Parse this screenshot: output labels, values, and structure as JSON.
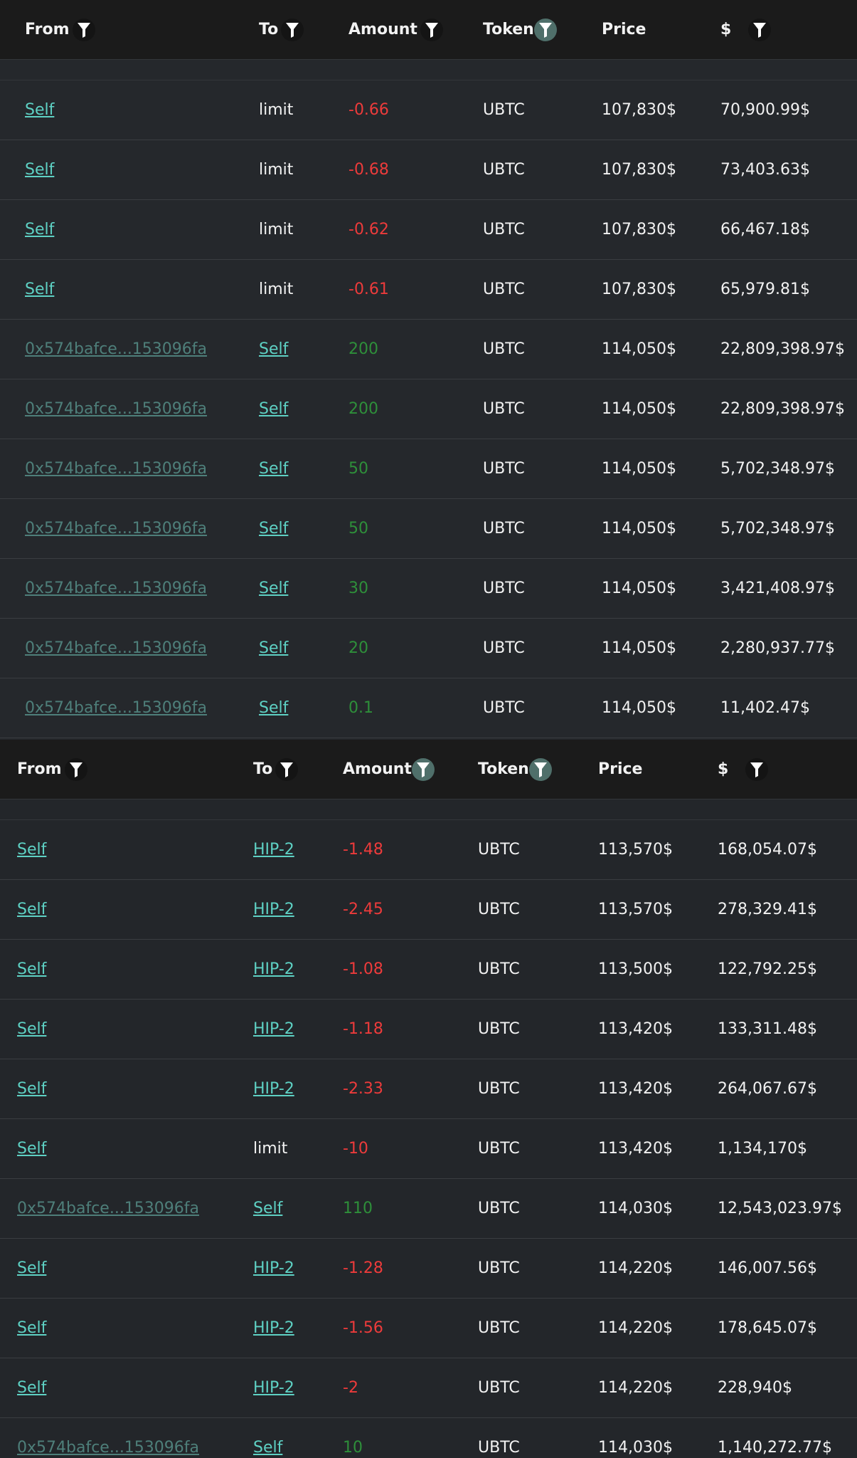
{
  "table1": {
    "headers": {
      "from": "From",
      "to": "To",
      "amount": "Amount",
      "token": "Token",
      "price": "Price",
      "usd": "$"
    },
    "active_filters": [
      "token"
    ],
    "rows": [
      {
        "from": "Self",
        "from_type": "link",
        "to": "limit",
        "to_type": "plain",
        "amount": "-0.66",
        "amount_sign": "neg",
        "token": "UBTC",
        "price": "107,830$",
        "usd": "70,900.99$"
      },
      {
        "from": "Self",
        "from_type": "link",
        "to": "limit",
        "to_type": "plain",
        "amount": "-0.68",
        "amount_sign": "neg",
        "token": "UBTC",
        "price": "107,830$",
        "usd": "73,403.63$"
      },
      {
        "from": "Self",
        "from_type": "link",
        "to": "limit",
        "to_type": "plain",
        "amount": "-0.62",
        "amount_sign": "neg",
        "token": "UBTC",
        "price": "107,830$",
        "usd": "66,467.18$"
      },
      {
        "from": "Self",
        "from_type": "link",
        "to": "limit",
        "to_type": "plain",
        "amount": "-0.61",
        "amount_sign": "neg",
        "token": "UBTC",
        "price": "107,830$",
        "usd": "65,979.81$"
      },
      {
        "from": "0x574bafce...153096fa",
        "from_type": "addr",
        "to": "Self",
        "to_type": "link",
        "amount": "200",
        "amount_sign": "pos",
        "token": "UBTC",
        "price": "114,050$",
        "usd": "22,809,398.97$"
      },
      {
        "from": "0x574bafce...153096fa",
        "from_type": "addr",
        "to": "Self",
        "to_type": "link",
        "amount": "200",
        "amount_sign": "pos",
        "token": "UBTC",
        "price": "114,050$",
        "usd": "22,809,398.97$"
      },
      {
        "from": "0x574bafce...153096fa",
        "from_type": "addr",
        "to": "Self",
        "to_type": "link",
        "amount": "50",
        "amount_sign": "pos",
        "token": "UBTC",
        "price": "114,050$",
        "usd": "5,702,348.97$"
      },
      {
        "from": "0x574bafce...153096fa",
        "from_type": "addr",
        "to": "Self",
        "to_type": "link",
        "amount": "50",
        "amount_sign": "pos",
        "token": "UBTC",
        "price": "114,050$",
        "usd": "5,702,348.97$"
      },
      {
        "from": "0x574bafce...153096fa",
        "from_type": "addr",
        "to": "Self",
        "to_type": "link",
        "amount": "30",
        "amount_sign": "pos",
        "token": "UBTC",
        "price": "114,050$",
        "usd": "3,421,408.97$"
      },
      {
        "from": "0x574bafce...153096fa",
        "from_type": "addr",
        "to": "Self",
        "to_type": "link",
        "amount": "20",
        "amount_sign": "pos",
        "token": "UBTC",
        "price": "114,050$",
        "usd": "2,280,937.77$"
      },
      {
        "from": "0x574bafce...153096fa",
        "from_type": "addr",
        "to": "Self",
        "to_type": "link",
        "amount": "0.1",
        "amount_sign": "pos",
        "token": "UBTC",
        "price": "114,050$",
        "usd": "11,402.47$"
      }
    ]
  },
  "table2": {
    "headers": {
      "from": "From",
      "to": "To",
      "amount": "Amount",
      "token": "Token",
      "price": "Price",
      "usd": "$"
    },
    "active_filters": [
      "amount",
      "token"
    ],
    "rows": [
      {
        "from": "Self",
        "from_type": "link",
        "to": "HIP-2",
        "to_type": "link",
        "amount": "-1.48",
        "amount_sign": "neg",
        "token": "UBTC",
        "price": "113,570$",
        "usd": "168,054.07$"
      },
      {
        "from": "Self",
        "from_type": "link",
        "to": "HIP-2",
        "to_type": "link",
        "amount": "-2.45",
        "amount_sign": "neg",
        "token": "UBTC",
        "price": "113,570$",
        "usd": "278,329.41$"
      },
      {
        "from": "Self",
        "from_type": "link",
        "to": "HIP-2",
        "to_type": "link",
        "amount": "-1.08",
        "amount_sign": "neg",
        "token": "UBTC",
        "price": "113,500$",
        "usd": "122,792.25$"
      },
      {
        "from": "Self",
        "from_type": "link",
        "to": "HIP-2",
        "to_type": "link",
        "amount": "-1.18",
        "amount_sign": "neg",
        "token": "UBTC",
        "price": "113,420$",
        "usd": "133,311.48$"
      },
      {
        "from": "Self",
        "from_type": "link",
        "to": "HIP-2",
        "to_type": "link",
        "amount": "-2.33",
        "amount_sign": "neg",
        "token": "UBTC",
        "price": "113,420$",
        "usd": "264,067.67$"
      },
      {
        "from": "Self",
        "from_type": "link",
        "to": "limit",
        "to_type": "plain",
        "amount": "-10",
        "amount_sign": "neg",
        "token": "UBTC",
        "price": "113,420$",
        "usd": "1,134,170$"
      },
      {
        "from": "0x574bafce...153096fa",
        "from_type": "addr",
        "to": "Self",
        "to_type": "link",
        "amount": "110",
        "amount_sign": "pos",
        "token": "UBTC",
        "price": "114,030$",
        "usd": "12,543,023.97$"
      },
      {
        "from": "Self",
        "from_type": "link",
        "to": "HIP-2",
        "to_type": "link",
        "amount": "-1.28",
        "amount_sign": "neg",
        "token": "UBTC",
        "price": "114,220$",
        "usd": "146,007.56$"
      },
      {
        "from": "Self",
        "from_type": "link",
        "to": "HIP-2",
        "to_type": "link",
        "amount": "-1.56",
        "amount_sign": "neg",
        "token": "UBTC",
        "price": "114,220$",
        "usd": "178,645.07$"
      },
      {
        "from": "Self",
        "from_type": "link",
        "to": "HIP-2",
        "to_type": "link",
        "amount": "-2",
        "amount_sign": "neg",
        "token": "UBTC",
        "price": "114,220$",
        "usd": "228,940$"
      },
      {
        "from": "0x574bafce...153096fa",
        "from_type": "addr",
        "to": "Self",
        "to_type": "link",
        "amount": "10",
        "amount_sign": "pos",
        "token": "UBTC",
        "price": "114,030$",
        "usd": "1,140,272.77$"
      }
    ]
  },
  "icons": {
    "filter": "filter-funnel-icon"
  },
  "colors": {
    "link": "#5ed1c4",
    "address": "#4e7f7a",
    "negative": "#ed3b3b",
    "positive": "#2e8f3a",
    "header_bg": "#1b1b1b",
    "active_filter": "#4f6f6a"
  }
}
